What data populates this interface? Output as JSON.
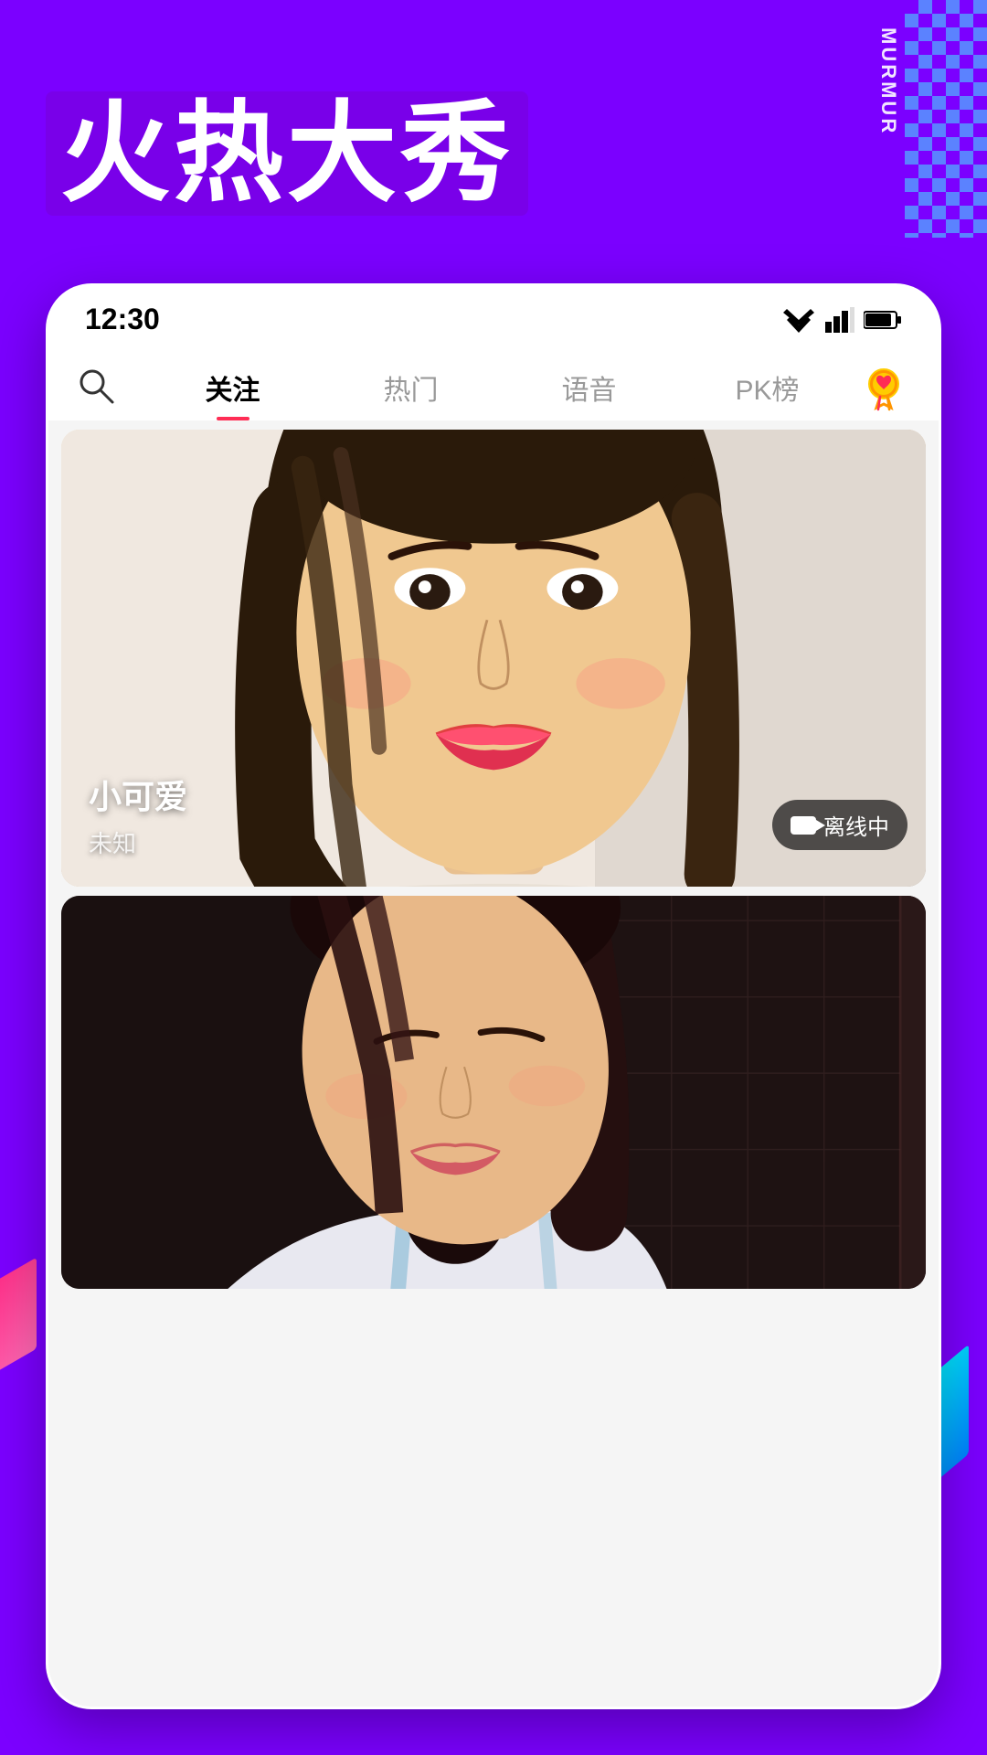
{
  "app": {
    "brand": "MURMUR",
    "hero_title": "火热大秀"
  },
  "status_bar": {
    "time": "12:30"
  },
  "nav": {
    "tabs": [
      {
        "id": "follow",
        "label": "关注",
        "active": true
      },
      {
        "id": "hot",
        "label": "热门",
        "active": false
      },
      {
        "id": "voice",
        "label": "语音",
        "active": false
      },
      {
        "id": "pk",
        "label": "PK榜",
        "active": false
      }
    ]
  },
  "streams": [
    {
      "id": 1,
      "name": "小可爱",
      "subtitle": "未知",
      "status": "offline",
      "status_label": "离线中"
    },
    {
      "id": 2,
      "name": "",
      "subtitle": "",
      "status": "offline",
      "status_label": ""
    }
  ],
  "colors": {
    "primary_purple": "#7B00FF",
    "accent_pink": "#FF2D55",
    "accent_cyan": "#00FFFF",
    "checker_blue": "#5599FF"
  }
}
